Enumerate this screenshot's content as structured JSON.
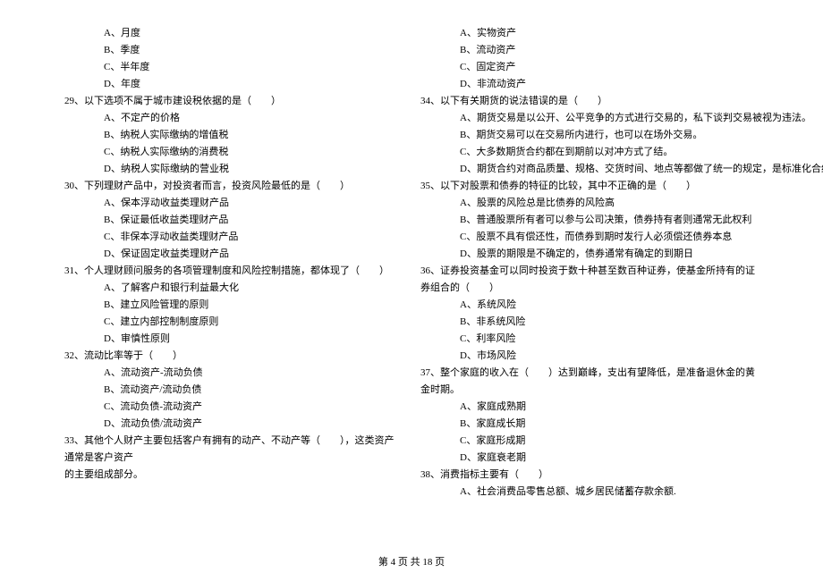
{
  "left": {
    "q28_options": {
      "a": "A、月度",
      "b": "B、季度",
      "c": "C、半年度",
      "d": "D、年度"
    },
    "q29": {
      "stem": "29、以下选项不属于城市建设税依据的是（　　）",
      "a": "A、不定产的价格",
      "b": "B、纳税人实际缴纳的增值税",
      "c": "C、纳税人实际缴纳的消费税",
      "d": "D、纳税人实际缴纳的营业税"
    },
    "q30": {
      "stem": "30、下列理财产品中，对投资者而言，投资风险最低的是（　　）",
      "a": "A、保本浮动收益类理财产品",
      "b": "B、保证最低收益类理财产品",
      "c": "C、非保本浮动收益类理财产品",
      "d": "D、保证固定收益类理财产品"
    },
    "q31": {
      "stem": "31、个人理财顾问服务的各项管理制度和风险控制措施，都体现了（　　）",
      "a": "A、了解客户和银行利益最大化",
      "b": "B、建立风险管理的原则",
      "c": "C、建立内部控制制度原则",
      "d": "D、审慎性原则"
    },
    "q32": {
      "stem": "32、流动比率等于（　　）",
      "a": "A、流动资产-流动负债",
      "b": "B、流动资产/流动负债",
      "c": "C、流动负债-流动资产",
      "d": "D、流动负债/流动资产"
    },
    "q33": {
      "stem1": "33、其他个人财产主要包括客户有拥有的动产、不动产等（　　），这类资产通常是客户资产",
      "stem2": "的主要组成部分。"
    }
  },
  "right": {
    "q33_options": {
      "a": "A、实物资产",
      "b": "B、流动资产",
      "c": "C、固定资产",
      "d": "D、非流动资产"
    },
    "q34": {
      "stem": "34、以下有关期货的说法错误的是（　　）",
      "a": "A、期货交易是以公开、公平竞争的方式进行交易的，私下谈判交易被视为违法。",
      "b": "B、期货交易可以在交易所内进行，也可以在场外交易。",
      "c": "C、大多数期货合约都在到期前以对冲方式了结。",
      "d": "D、期货合约对商品质量、规格、交货时间、地点等都做了统一的规定，是标准化合约。"
    },
    "q35": {
      "stem": "35、以下对股票和债券的特征的比较，其中不正确的是（　　）",
      "a": "A、股票的风险总是比债券的风险高",
      "b": "B、普通股票所有者可以参与公司决策，债券持有者则通常无此权利",
      "c": "C、股票不具有偿还性，而债券到期时发行人必须偿还债券本息",
      "d": "D、股票的期限是不确定的，债券通常有确定的到期日"
    },
    "q36": {
      "stem": "36、证券投资基金可以同时投资于数十种甚至数百种证券，使基金所持有的证券组合的（　　）",
      "a": "A、系统风险",
      "b": "B、非系统风险",
      "c": "C、利率风险",
      "d": "D、市场风险"
    },
    "q37": {
      "stem": "37、整个家庭的收入在（　　）达到巅峰，支出有望降低，是准备退休金的黄金时期。",
      "a": "A、家庭成熟期",
      "b": "B、家庭成长期",
      "c": "C、家庭形成期",
      "d": "D、家庭衰老期"
    },
    "q38": {
      "stem": "38、消费指标主要有（　　）",
      "a": "A、社会消费品零售总额、城乡居民储蓄存款余额."
    }
  },
  "footer": "第 4 页 共 18 页"
}
